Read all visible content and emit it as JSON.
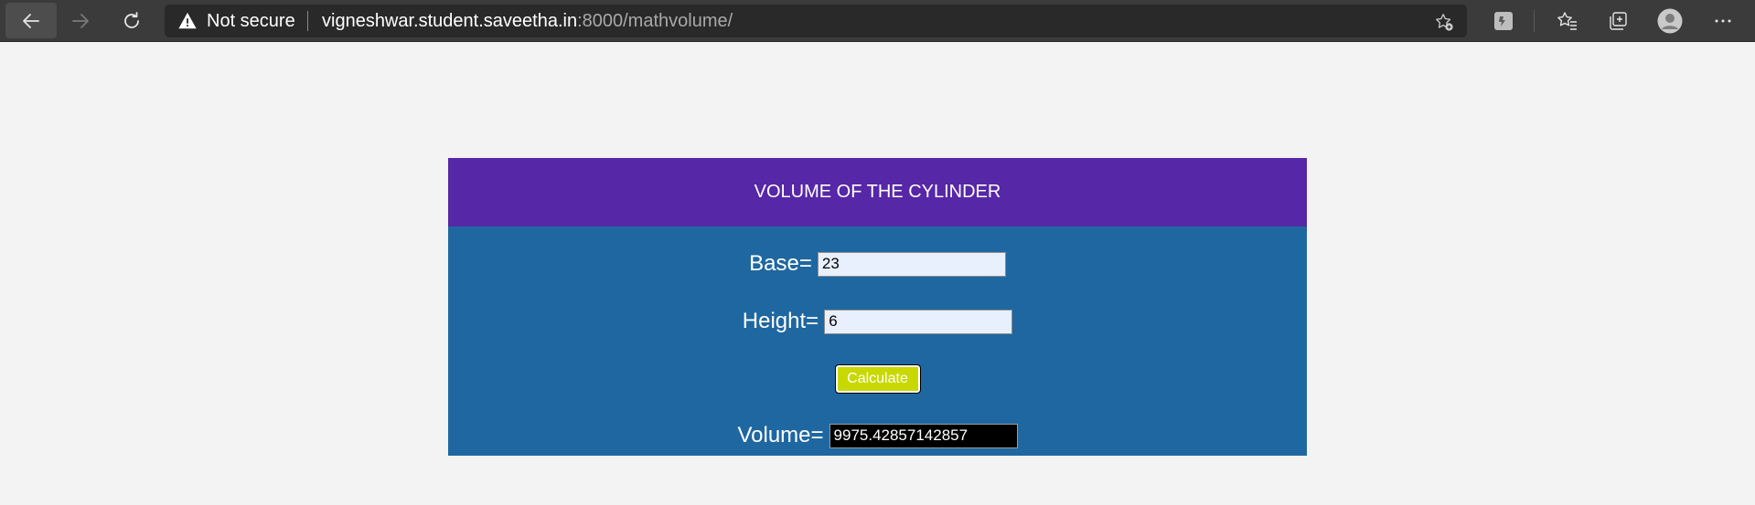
{
  "browser": {
    "security_label": "Not secure",
    "url_host": "vigneshwar.student.saveetha.in",
    "url_rest": ":8000/mathvolume/"
  },
  "page": {
    "title": "VOLUME OF THE CYLINDER",
    "base_label": "Base=",
    "base_value": "23",
    "height_label": "Height=",
    "height_value": "6",
    "calculate_label": "Calculate",
    "volume_label": "Volume=",
    "volume_value": "9975.42857142857"
  },
  "colors": {
    "header_bg": "#5627a6",
    "body_bg": "#1f67a0",
    "button_bg": "#c8d800",
    "page_bg": "#f3f3f3"
  }
}
